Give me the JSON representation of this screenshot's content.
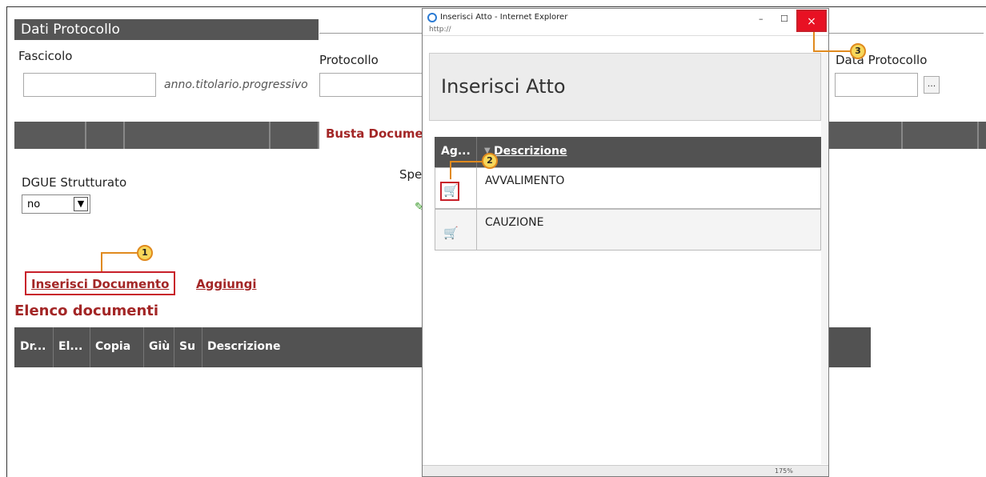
{
  "section": {
    "title": "Dati Protocollo"
  },
  "fields": {
    "fascicolo_label": "Fascicolo",
    "fascicolo_hint": "anno.titolario.progressivo",
    "protocollo_label": "Protocollo",
    "data_protocollo_label": "Data Protocollo",
    "date_button": "..."
  },
  "tabs": {
    "active": "Busta Documentazione"
  },
  "dgue": {
    "label": "DGUE Strutturato",
    "value": "no",
    "spe_label": "Spe"
  },
  "actions": {
    "inserisci": "Inserisci Documento",
    "aggiungi": "Aggiungi"
  },
  "elenco": {
    "title": "Elenco documenti",
    "columns": [
      "Dr...",
      "El...",
      "Copia",
      "Giù",
      "Su",
      "Descrizione"
    ]
  },
  "popup": {
    "window_title": "Inserisci Atto - Internet Explorer",
    "address": "http://",
    "header": "Inserisci Atto",
    "col_ag": "Ag...",
    "col_desc": "Descrizione",
    "rows": [
      "AVVALIMENTO",
      "CAUZIONE"
    ],
    "zoom": "175%",
    "close_glyph": "×",
    "minimize_glyph": "–",
    "maximize_glyph": "☐"
  },
  "callouts": [
    "1",
    "2",
    "3"
  ],
  "colors": {
    "accent_red": "#a32626",
    "callout_fill": "#f7d75a",
    "close_red": "#e81123"
  }
}
